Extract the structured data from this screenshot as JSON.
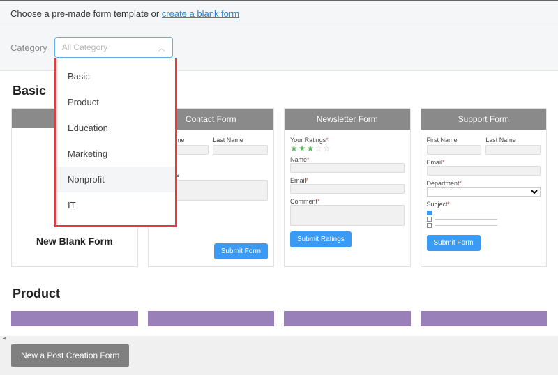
{
  "topbar": {
    "prefix": "Choose a pre-made form template or ",
    "link": "create a blank form"
  },
  "category": {
    "label": "Category",
    "placeholder": "All Category"
  },
  "dropdown": {
    "items": [
      "Basic",
      "Product",
      "Education",
      "Marketing",
      "Nonprofit",
      "IT"
    ],
    "hoverIndex": 4
  },
  "sections": {
    "basic": {
      "title": "Basic",
      "cards": [
        {
          "title": "",
          "blank": true,
          "blank_label": "New Blank Form"
        },
        {
          "title": "Contact Form",
          "fields": {
            "fname": "First Name",
            "lname": "Last Name",
            "msg": "Message"
          },
          "submit": "Submit Form"
        },
        {
          "title": "Newsletter Form",
          "fields": {
            "ratings_label": "Your Ratings",
            "name": "Name",
            "email": "Email",
            "comment": "Comment"
          },
          "submit": "Submit Ratings"
        },
        {
          "title": "Support Form",
          "fields": {
            "fname": "First Name",
            "lname": "Last Name",
            "email": "Email",
            "dept": "Department",
            "subject": "Subject"
          },
          "submit": "Submit Form"
        }
      ]
    },
    "product": {
      "title": "Product"
    }
  },
  "footer": {
    "button": "New a Post Creation Form"
  }
}
